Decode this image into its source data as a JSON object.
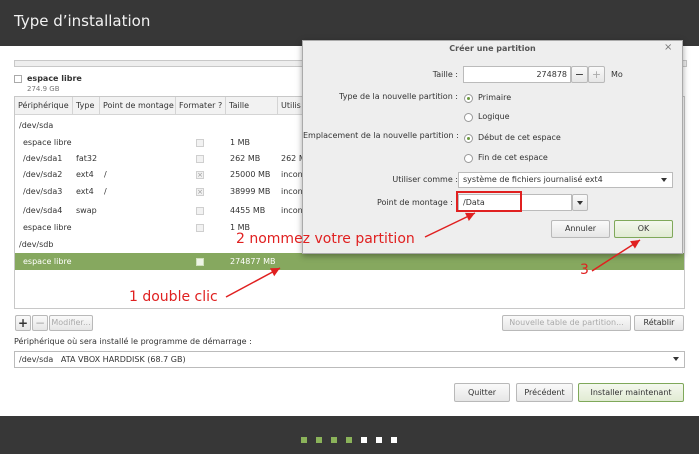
{
  "window": {
    "title": "Type d’installation"
  },
  "free_space": {
    "label": "espace libre",
    "size": "274.9 GB"
  },
  "table": {
    "headers": [
      "Périphérique",
      "Type",
      "Point de montage",
      "Formater ?",
      "Taille",
      "Utilis"
    ],
    "rows": [
      {
        "device": "/dev/sda",
        "type": "",
        "mount": "",
        "format": null,
        "size": "",
        "used": ""
      },
      {
        "device": "espace libre",
        "type": "",
        "mount": "",
        "format": "unchecked",
        "size": "1 MB",
        "used": ""
      },
      {
        "device": "/dev/sda1",
        "type": "fat32",
        "mount": "",
        "format": "unchecked",
        "size": "262 MB",
        "used": "262 M"
      },
      {
        "device": "/dev/sda2",
        "type": "ext4",
        "mount": "/",
        "format": "checked",
        "size": "25000 MB",
        "used": "incon"
      },
      {
        "device": "/dev/sda3",
        "type": "ext4",
        "mount": "/",
        "format": "checked",
        "size": "38999 MB",
        "used": "incon"
      },
      {
        "device": "/dev/sda4",
        "type": "swap",
        "mount": "",
        "format": "unchecked",
        "size": "4455 MB",
        "used": "incon"
      },
      {
        "device": "espace libre",
        "type": "",
        "mount": "",
        "format": "unchecked",
        "size": "1 MB",
        "used": ""
      },
      {
        "device": "/dev/sdb",
        "type": "",
        "mount": "",
        "format": null,
        "size": "",
        "used": ""
      },
      {
        "device": "espace libre",
        "type": "",
        "mount": "",
        "format": "unchecked",
        "size": "274877 MB",
        "used": "",
        "selected": true
      }
    ]
  },
  "toolbar": {
    "add": "+",
    "remove": "−",
    "modify": "Modifier...",
    "new_table": "Nouvelle table de partition...",
    "restore": "Rétablir"
  },
  "bootloader": {
    "label": "Périphérique où sera installé le programme de démarrage :",
    "device": "/dev/sda",
    "description": "ATA VBOX HARDDISK (68.7 GB)"
  },
  "footer": {
    "quit": "Quitter",
    "back": "Précédent",
    "install": "Installer maintenant"
  },
  "progress_dots": {
    "total": 7,
    "completed": 4,
    "colors": {
      "done": "#8bb35a",
      "todo": "#ffffff"
    }
  },
  "dialog": {
    "title": "Créer une partition",
    "close": "×",
    "size_label": "Taille :",
    "size_value": "274878",
    "size_unit": "Mo",
    "type_label": "Type de la nouvelle partition :",
    "type_options": [
      "Primaire",
      "Logique"
    ],
    "type_selected": 0,
    "location_label": "Emplacement de la nouvelle partition :",
    "location_options": [
      "Début de cet espace",
      "Fin de cet espace"
    ],
    "location_selected": 0,
    "use_as_label": "Utiliser comme :",
    "use_as_value": "système de fichiers journalisé ext4",
    "mount_label": "Point de montage :",
    "mount_value": "/Data",
    "cancel": "Annuler",
    "ok": "OK"
  },
  "annotations": {
    "step1": "1 double clic",
    "step2": "2 nommez votre partition",
    "step3": "3"
  },
  "colors": {
    "accent": "#86a85f",
    "annotation": "#e02020",
    "titlebar": "#373737"
  }
}
